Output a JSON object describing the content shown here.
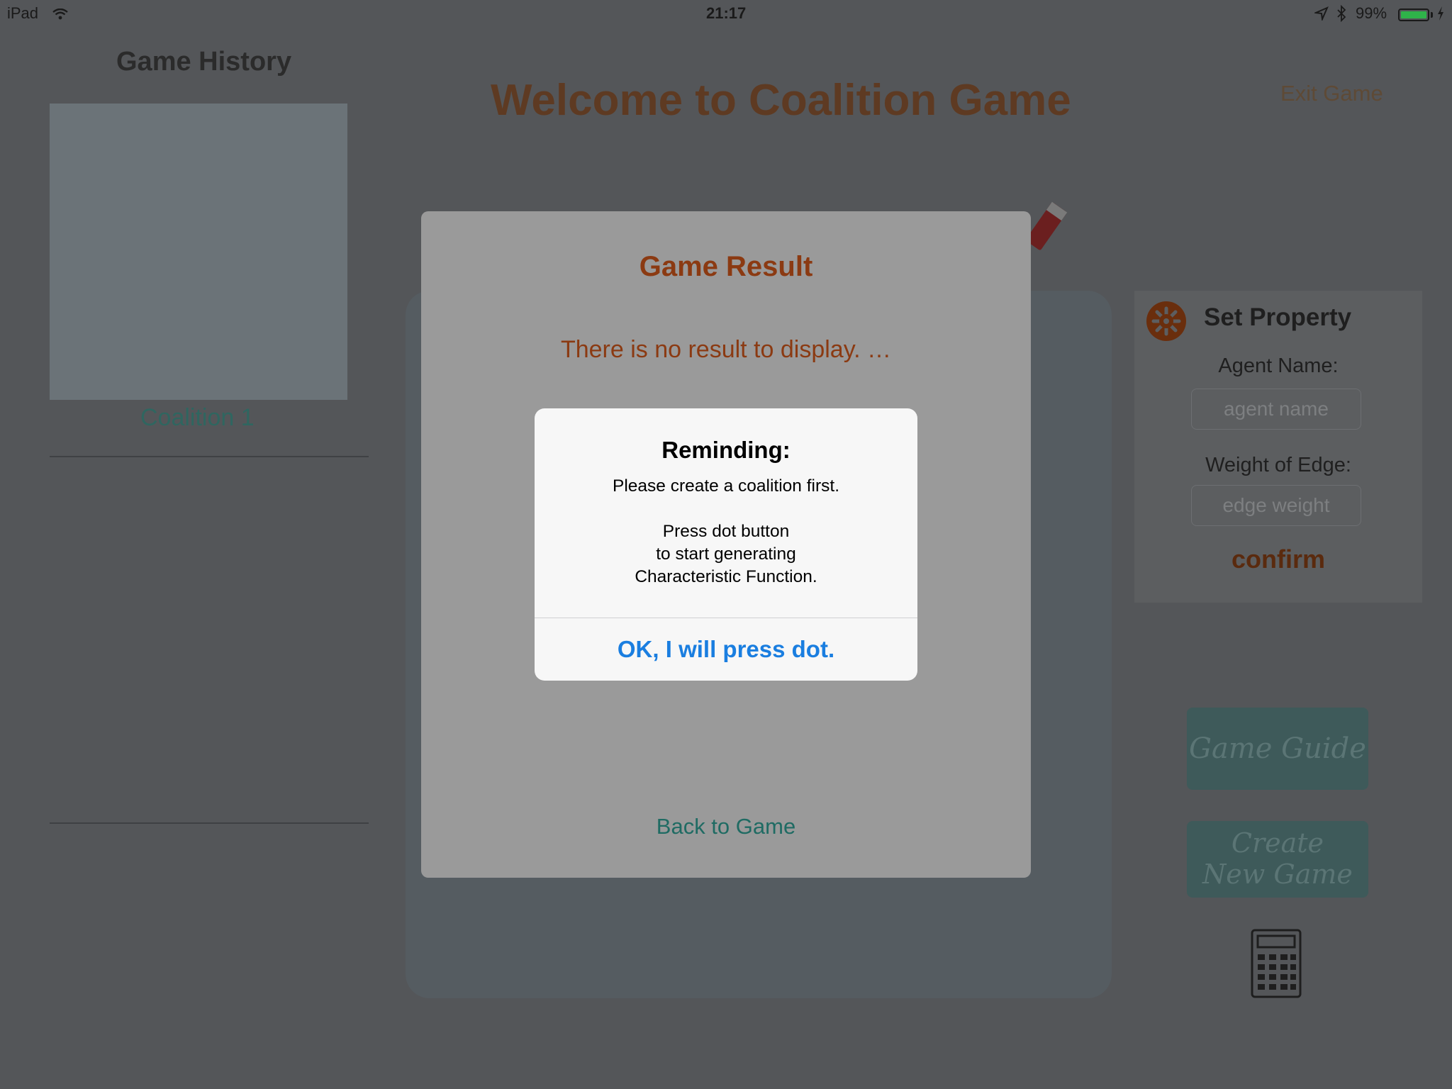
{
  "status_bar": {
    "device": "iPad",
    "time": "21:17",
    "battery_percent": "99%",
    "battery_level": 0.99,
    "icons": [
      "wifi-icon",
      "location-icon",
      "bluetooth-icon",
      "battery-icon",
      "charging-icon"
    ]
  },
  "history": {
    "title": "Game History",
    "coalition_label": "Coalition 1"
  },
  "header": {
    "title": "Welcome to Coalition Game",
    "exit_label": "Exit Game"
  },
  "set_property": {
    "title": "Set Property",
    "agent_name_label": "Agent Name:",
    "agent_name_placeholder": "agent name",
    "weight_label": "Weight of Edge:",
    "weight_placeholder": "edge weight",
    "confirm_label": "confirm"
  },
  "side_buttons": {
    "guide_label": "Game Guide",
    "create_label": "Create\nNew Game"
  },
  "result_sheet": {
    "title": "Game Result",
    "message": "There is no result to display. …",
    "back_label": "Back to Game"
  },
  "alert": {
    "title": "Reminding:",
    "message": "Please create a coalition first.\n\nPress dot button\nto start generating\nCharacteristic Function.",
    "button_label": "OK, I will press dot."
  },
  "colors": {
    "accent_blue": "#1a7ee0",
    "title_brown": "#8b3a12",
    "teal": "#1f6b63",
    "battery_green": "#2fb34a"
  }
}
